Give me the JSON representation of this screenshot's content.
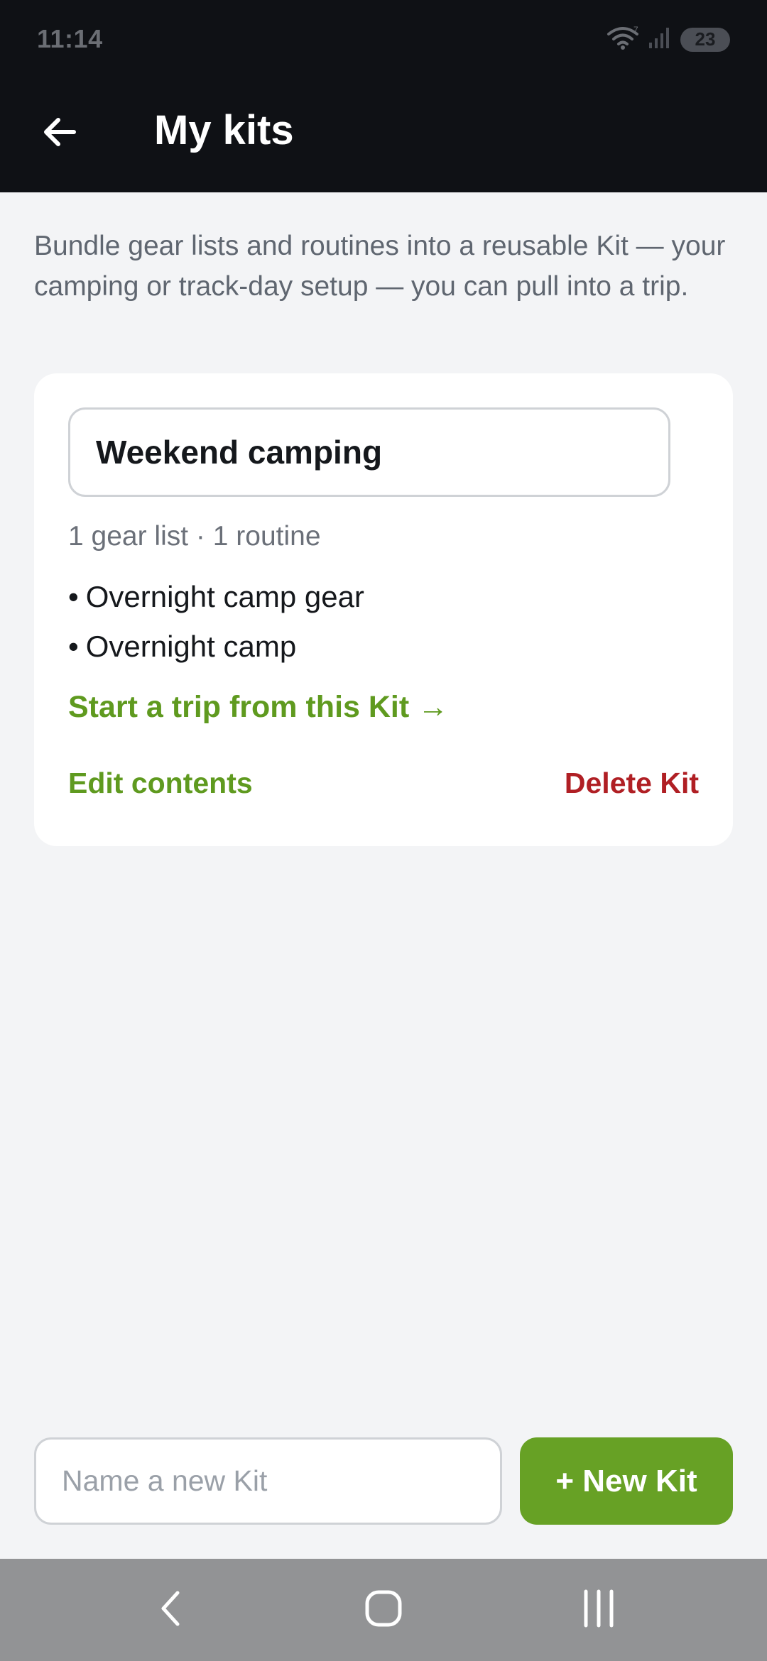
{
  "status_bar": {
    "time": "11:14",
    "battery": "23",
    "icons": [
      "wifi-icon",
      "signal-icon",
      "battery-icon"
    ]
  },
  "app_bar": {
    "back_icon": "arrow-left-icon",
    "title": "My kits"
  },
  "intro_text": "Bundle gear lists and routines into a reusable Kit — your camping or track-day setup — you can pull into a trip.",
  "kits": [
    {
      "name": "Weekend camping",
      "summary": "1 gear list · 1 routine",
      "items": [
        "Overnight camp gear",
        "Overnight camp"
      ],
      "start_trip_label": "Start a trip from this Kit →",
      "edit_label": "Edit contents",
      "delete_label": "Delete Kit"
    }
  ],
  "new_kit": {
    "placeholder": "Name a new Kit",
    "value": "",
    "button_label": "+ New Kit"
  },
  "nav": {
    "icons": [
      "back-nav-icon",
      "home-nav-icon",
      "recents-nav-icon"
    ]
  },
  "colors": {
    "accent_green": "#67a125",
    "link_green": "#5f9a1f",
    "danger_red": "#b01f24",
    "header_bg": "#0f1115",
    "page_bg": "#f3f4f6"
  }
}
